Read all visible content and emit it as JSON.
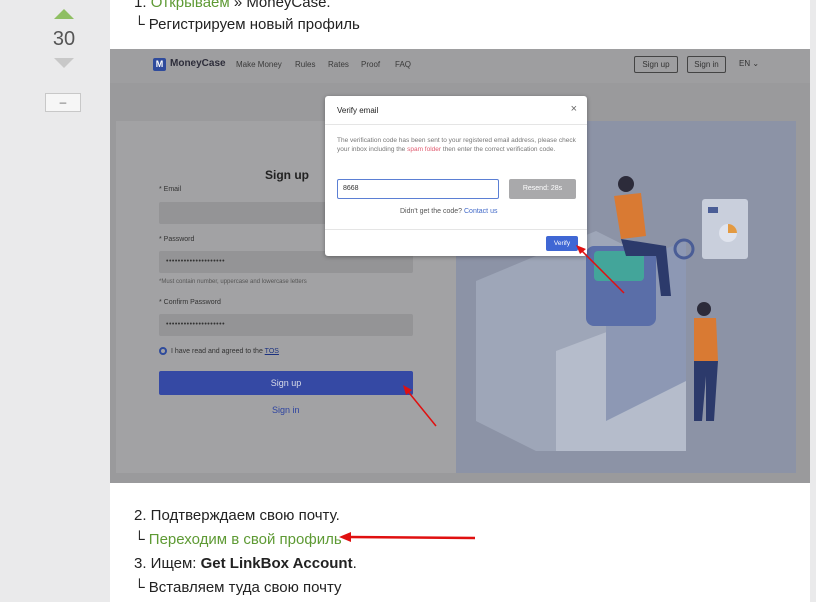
{
  "vote": {
    "score": "30",
    "collapse_label": "–"
  },
  "post": {
    "line1_num": "1. ",
    "line1_link": "Открываем",
    "line1_rest": " » MoneyCase.",
    "line2": "└ Регистрируем новый профиль",
    "line3": "2. Подтверждаем свою почту.",
    "line4_prefix": "└ ",
    "line4_link": "Переходим в свой профиль",
    "line5_prefix": "3. Ищем: ",
    "line5_bold": "Get LinkBox Account",
    "line5_suffix": ".",
    "line6": "└ Вставляем туда свою почту"
  },
  "screenshot": {
    "logo_letter": "M",
    "logo_text": "MoneyCase",
    "nav": [
      "Make Money",
      "Rules",
      "Rates",
      "Proof",
      "FAQ"
    ],
    "signup_btn": "Sign up",
    "signin_btn": "Sign in",
    "lang": "EN ⌄",
    "form": {
      "title": "Sign up",
      "email_label": "* Email",
      "password_label": "* Password",
      "password_dots": "••••••••••••••••••••",
      "password_hint": "*Must contain number, uppercase and lowercase letters",
      "confirm_label": "* Confirm Password",
      "confirm_dots": "••••••••••••••••••••",
      "tos_text": "I have read and agreed to the ",
      "tos_link": "TOS",
      "submit": "Sign up",
      "signin": "Sign in"
    },
    "modal": {
      "title": "Verify email",
      "close": "×",
      "text_before": "The verification code has been sent to your registered email address, please check your inbox including the ",
      "spam": "spam folder",
      "text_after": " then enter the correct verification code.",
      "code_value": "8668",
      "resend": "Resend: 28s",
      "didnt": "Didn't get the code? ",
      "contact": "Contact us",
      "verify": "Verify"
    }
  },
  "colors": {
    "accent_green": "#5e9a34",
    "annotation_red": "#e01010",
    "brand_blue": "#2f4b9c"
  }
}
